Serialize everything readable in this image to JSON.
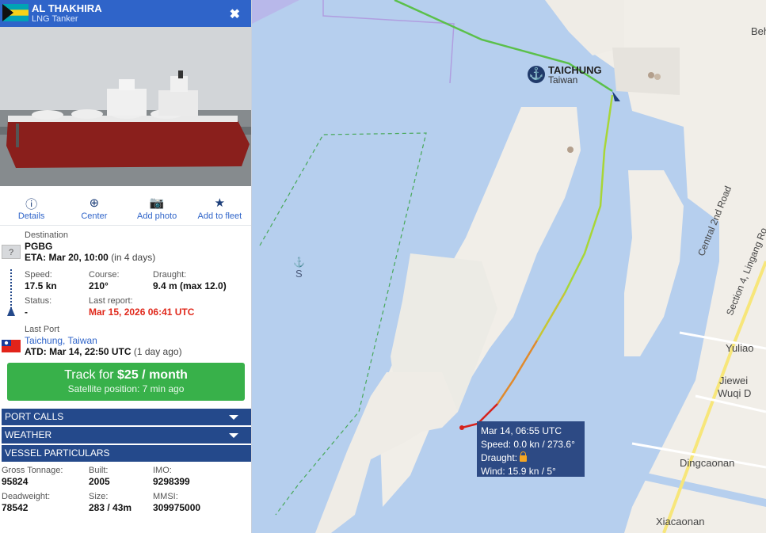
{
  "vessel": {
    "name": "AL THAKHIRA",
    "type": "LNG Tanker"
  },
  "actions": [
    {
      "label": "Details",
      "icon": "info-icon"
    },
    {
      "label": "Center",
      "icon": "crosshair-icon"
    },
    {
      "label": "Add photo",
      "icon": "camera-icon"
    },
    {
      "label": "Add to fleet",
      "icon": "star-icon"
    }
  ],
  "voyage": {
    "destination_label": "Destination",
    "destination": "PGBG",
    "eta_label": "ETA:",
    "eta": "Mar 20, 10:00",
    "eta_rel": "(in 4 days)",
    "unknown_flag": "?",
    "speed_label": "Speed:",
    "speed": "17.5 kn",
    "course_label": "Course:",
    "course": "210°",
    "draught_label": "Draught:",
    "draught": "9.4 m (max 12.0)",
    "status_label": "Status:",
    "status": "-",
    "report_label": "Last report:",
    "report": "Mar 15, 2026 06:41 UTC",
    "lastport_label": "Last Port",
    "lastport": "Taichung, Taiwan",
    "atd_label": "ATD:",
    "atd": "Mar 14, 22:50 UTC",
    "atd_rel": "(1 day ago)"
  },
  "track": {
    "prefix": "Track for ",
    "price": "$25 / month",
    "sub": "Satellite position: 7 min ago"
  },
  "sections": [
    "PORT CALLS",
    "WEATHER",
    "VESSEL PARTICULARS"
  ],
  "particulars": {
    "gt_label": "Gross Tonnage:",
    "gt": "95824",
    "built_label": "Built:",
    "built": "2005",
    "imo_label": "IMO:",
    "imo": "9298399",
    "dwt_label": "Deadweight:",
    "dwt": "78542",
    "size_label": "Size:",
    "size": "283 / 43m",
    "mmsi_label": "MMSI:",
    "mmsi": "309975000"
  },
  "map": {
    "port_name": "TAICHUNG",
    "port_country": "Taiwan",
    "labels": [
      "Central 2nd Road",
      "Section 4, Lingang Ro",
      "Yuliao",
      "Jiewei",
      "Wuqi D",
      "Dingcaonan",
      "Xiacaonan",
      "Beh",
      "S"
    ],
    "tooltip": {
      "time": "Mar 14, 06:55 UTC",
      "speed": "Speed: 0.0 kn / 273.6°",
      "draught": "Draught:",
      "wind": "Wind: 15.9 kn / 5°"
    }
  },
  "colors": {
    "header": "#2f64c9",
    "section": "#24498b",
    "track_button": "#38b14a",
    "report_red": "#e0281b",
    "water": "#b6cfee",
    "land": "#f1eee8"
  }
}
